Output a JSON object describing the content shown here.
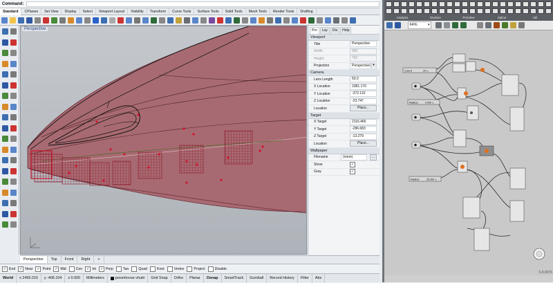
{
  "command": {
    "label": "Command:"
  },
  "ribbon_tabs": [
    "Standard",
    "CPlanes",
    "Set View",
    "Display",
    "Select",
    "Viewport Layout",
    "Visibility",
    "Transform",
    "Curve Tools",
    "Surface Tools",
    "Solid Tools",
    "Mesh Tools",
    "Render Tools",
    "Drafting"
  ],
  "viewport": {
    "title": "Perspective"
  },
  "panel_tabs": [
    "Pro",
    "Lay",
    "Dis",
    "Help"
  ],
  "viewport_props": {
    "section": "Viewport",
    "rows": [
      {
        "label": "Title",
        "value": "Perspective"
      },
      {
        "label": "Width",
        "value": "985"
      },
      {
        "label": "Height",
        "value": "792"
      },
      {
        "label": "Projection",
        "value": "Perspective"
      }
    ]
  },
  "camera": {
    "section": "Camera",
    "rows": [
      {
        "label": "Lens Length",
        "value": "50.0"
      },
      {
        "label": "X Location",
        "value": "2381.176"
      },
      {
        "label": "Y Location",
        "value": "-372.110"
      },
      {
        "label": "Z Location",
        "value": "-23.747"
      }
    ],
    "location_label": "Location",
    "place_button": "Place..."
  },
  "target": {
    "section": "Target",
    "rows": [
      {
        "label": "X Target",
        "value": "2116.466"
      },
      {
        "label": "Y Target",
        "value": "-286.683"
      },
      {
        "label": "Z Target",
        "value": "-13.279"
      }
    ],
    "location_label": "Location",
    "place_button": "Place..."
  },
  "wallpaper": {
    "section": "Wallpaper",
    "filename_label": "Filename",
    "filename_value": "(none)",
    "show_label": "Show",
    "gray_label": "Gray",
    "browse": "..."
  },
  "view_tabs": [
    "Perspective",
    "Top",
    "Front",
    "Right",
    "+"
  ],
  "osnap": [
    {
      "label": "End",
      "checked": true
    },
    {
      "label": "Near",
      "checked": true
    },
    {
      "label": "Point",
      "checked": true
    },
    {
      "label": "Mid",
      "checked": true
    },
    {
      "label": "Cen",
      "checked": false
    },
    {
      "label": "Int",
      "checked": true
    },
    {
      "label": "Perp",
      "checked": true
    },
    {
      "label": "Tan",
      "checked": false
    },
    {
      "label": "Quad",
      "checked": false
    },
    {
      "label": "Knot",
      "checked": false
    },
    {
      "label": "Vertex",
      "checked": false
    },
    {
      "label": "Project",
      "checked": false
    },
    {
      "label": "Disable",
      "checked": false
    }
  ],
  "status": {
    "cplane": "World",
    "x": "x 2495.015",
    "y": "y -406.104",
    "z": "z 0.000",
    "units": "Millimeters",
    "layer": "poverhnvse vhutri",
    "toggles": [
      "Grid Snap",
      "Ortho",
      "Planar",
      "Osnap",
      "SmartTrack",
      "Gumball",
      "Record History",
      "Filter",
      "Abs"
    ]
  },
  "grasshopper": {
    "categories": [
      "Analysis",
      "Division",
      "Primitive",
      "Spline",
      "Util"
    ],
    "zoom": "64%",
    "version": "0.9.0076",
    "sliders": [
      {
        "label": "Count",
        "value": "20 ◇"
      },
      {
        "label": "Radius",
        "value": "0.000 ◇"
      },
      {
        "label": "Radius",
        "value": "20.000 ◇"
      }
    ]
  },
  "colors": {
    "surface": "#a86a72",
    "points": "#d2112a",
    "accent": "#2a62c9"
  }
}
